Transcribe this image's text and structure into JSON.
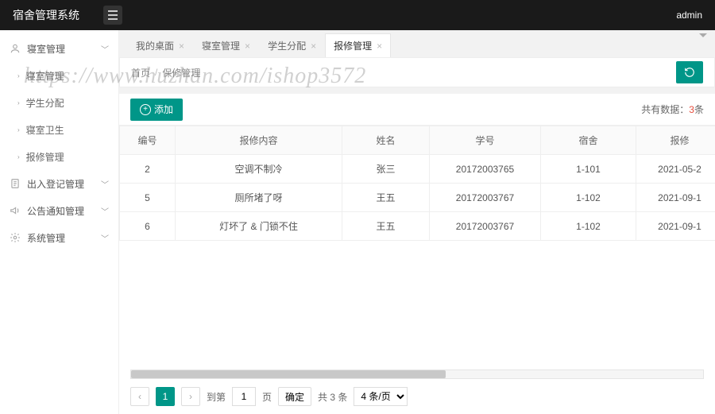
{
  "system_title": "宿舍管理系统",
  "user": {
    "name": "admin"
  },
  "sidebar": {
    "items": [
      {
        "label": "寝室管理",
        "icon": "user"
      },
      {
        "label": "寝室管理",
        "sub": true
      },
      {
        "label": "学生分配",
        "sub": true
      },
      {
        "label": "寝室卫生",
        "sub": true
      },
      {
        "label": "报修管理",
        "sub": true
      },
      {
        "label": "出入登记管理",
        "icon": "doc"
      },
      {
        "label": "公告通知管理",
        "icon": "horn"
      },
      {
        "label": "系统管理",
        "icon": "gear"
      }
    ]
  },
  "tabs": [
    {
      "label": "我的桌面"
    },
    {
      "label": "寝室管理"
    },
    {
      "label": "学生分配"
    },
    {
      "label": "报修管理"
    }
  ],
  "breadcrumb": {
    "home": "首页",
    "current": "保修管理"
  },
  "toolbar": {
    "add_label": "添加"
  },
  "count": {
    "prefix": "共有数据：",
    "value": "3",
    "suffix": "条"
  },
  "table": {
    "headers": {
      "id": "编号",
      "content": "报修内容",
      "name": "姓名",
      "sid": "学号",
      "room": "宿舍",
      "date": "报修"
    },
    "rows": [
      {
        "id": "2",
        "content": "空调不制冷",
        "name": "张三",
        "sid": "20172003765",
        "room": "1-101",
        "date": "2021-05-2"
      },
      {
        "id": "5",
        "content": "厕所堵了呀",
        "name": "王五",
        "sid": "20172003767",
        "room": "1-102",
        "date": "2021-09-1"
      },
      {
        "id": "6",
        "content": "灯坏了 & 门锁不住",
        "name": "王五",
        "sid": "20172003767",
        "room": "1-102",
        "date": "2021-09-1"
      }
    ]
  },
  "pager": {
    "page": "1",
    "goto_label": "到第",
    "page_label": "页",
    "confirm": "确定",
    "total": "共 3 条",
    "per_page": "4 条/页"
  },
  "watermark": "https://www.huzhan.com/ishop3572"
}
